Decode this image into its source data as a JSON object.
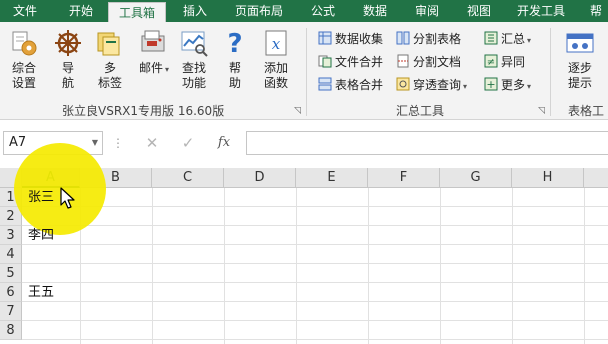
{
  "tabs": [
    "文件",
    "开始",
    "工具箱",
    "插入",
    "页面布局",
    "公式",
    "数据",
    "审阅",
    "视图",
    "开发工具",
    "帮"
  ],
  "ribbon": {
    "group1": {
      "buttons": [
        {
          "line1": "综合",
          "line2": "设置",
          "icon": "settings-icon"
        },
        {
          "line1": "导",
          "line2": "航",
          "icon": "ship-wheel-icon"
        },
        {
          "line1": "多",
          "line2": "标签",
          "icon": "multi-tab-icon"
        },
        {
          "line1": "邮件",
          "line2": "",
          "icon": "mail-icon"
        },
        {
          "line1": "查找",
          "line2": "功能",
          "icon": "find-icon"
        },
        {
          "line1": "帮",
          "line2": "助",
          "icon": "help-icon"
        },
        {
          "line1": "添加",
          "line2": "函数",
          "icon": "function-icon"
        }
      ],
      "label": "张立良VSRX1专用版 16.60版"
    },
    "group2": {
      "col1": [
        "数据收集",
        "文件合并",
        "表格合并"
      ],
      "col2": [
        "分割表格",
        "分割文档",
        "穿透查询"
      ],
      "col3": [
        "汇总",
        "异同",
        "更多"
      ],
      "label": "汇总工具"
    },
    "group3": {
      "button": {
        "line1": "逐步",
        "line2": "提示"
      },
      "label": "表格工具"
    }
  },
  "formula_bar": {
    "name_box": "A7",
    "cancel_icon": "✕",
    "confirm_icon": "✓",
    "fx": "fx",
    "value": ""
  },
  "sheet": {
    "columns": [
      "A",
      "B",
      "C",
      "D",
      "E",
      "F",
      "G",
      "H"
    ],
    "selected_column": "A",
    "rows": [
      "1",
      "2",
      "3",
      "4",
      "5",
      "6",
      "7",
      "8"
    ],
    "cells": [
      {
        "row": "1",
        "col": "A",
        "value": "张三"
      },
      {
        "row": "3",
        "col": "A",
        "value": "李四"
      },
      {
        "row": "6",
        "col": "A",
        "value": "王五"
      }
    ]
  },
  "colors": {
    "accent": "#217346",
    "highlight": "#f5ea00"
  }
}
